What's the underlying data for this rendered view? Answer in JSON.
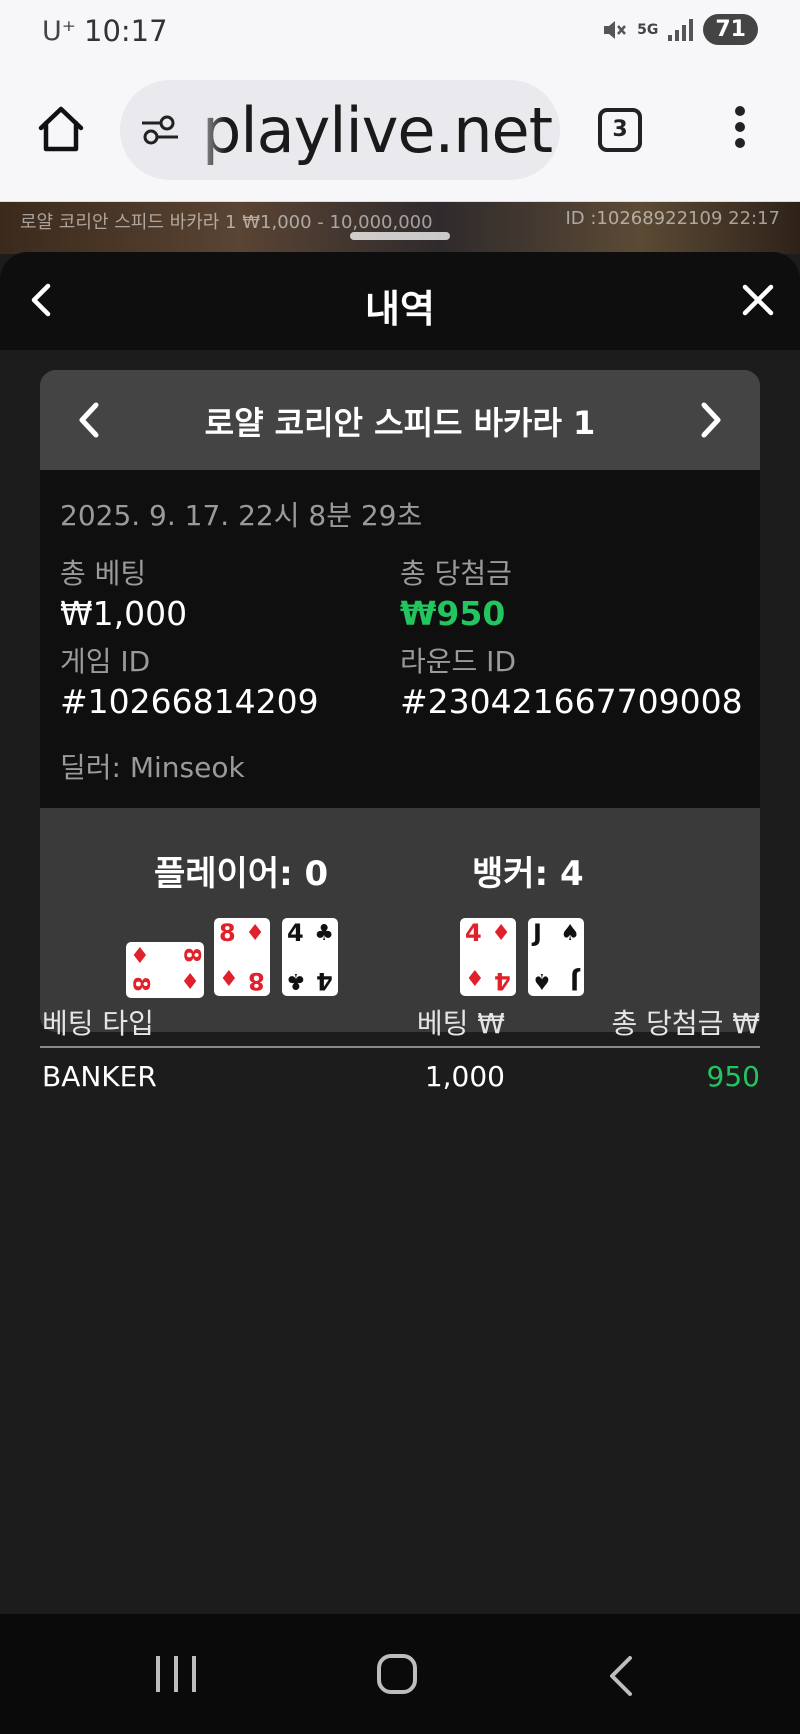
{
  "status_bar": {
    "carrier": "U⁺",
    "time": "10:17",
    "network": "5G",
    "battery": "71"
  },
  "browser": {
    "url": "playlive.net",
    "tab_count": "3"
  },
  "game_strip": {
    "left_text": "로얄 코리안 스피드 바카라 1 ₩1,000 - 10,000,000",
    "right_text": "ID :10268922109 22:17"
  },
  "sheet": {
    "title": "내역"
  },
  "card": {
    "game_title": "로얄 코리안 스피드 바카라 1",
    "datetime": "2025. 9. 17. 22시 8분 29초",
    "total_bet_label": "총 베팅",
    "total_bet_value": "₩1,000",
    "total_win_label": "총 당첨금",
    "total_win_value": "₩950",
    "game_id_label": "게임 ID",
    "game_id_value": "#10266814209",
    "round_id_label": "라운드 ID",
    "round_id_value": "#230421667709008",
    "dealer": "딜러: Minseok",
    "player_label": "플레이어: 0",
    "banker_label": "뱅커: 4",
    "player_cards": [
      {
        "rank": "8",
        "suit": "♦",
        "color": "red",
        "orientation": "sideways"
      },
      {
        "rank": "8",
        "suit": "♦",
        "color": "red",
        "orientation": "upright"
      },
      {
        "rank": "4",
        "suit": "♣",
        "color": "black",
        "orientation": "upright"
      }
    ],
    "banker_cards": [
      {
        "rank": "4",
        "suit": "♦",
        "color": "red",
        "orientation": "upright"
      },
      {
        "rank": "J",
        "suit": "♠",
        "color": "black",
        "orientation": "upright"
      }
    ]
  },
  "table": {
    "headers": [
      "베팅 타입",
      "베팅 ₩",
      "총 당첨금 ₩"
    ],
    "rows": [
      {
        "type": "BANKER",
        "bet": "1,000",
        "win": "950"
      }
    ]
  },
  "colors": {
    "win_green": "#22c55e",
    "card_red": "#e0202b"
  }
}
